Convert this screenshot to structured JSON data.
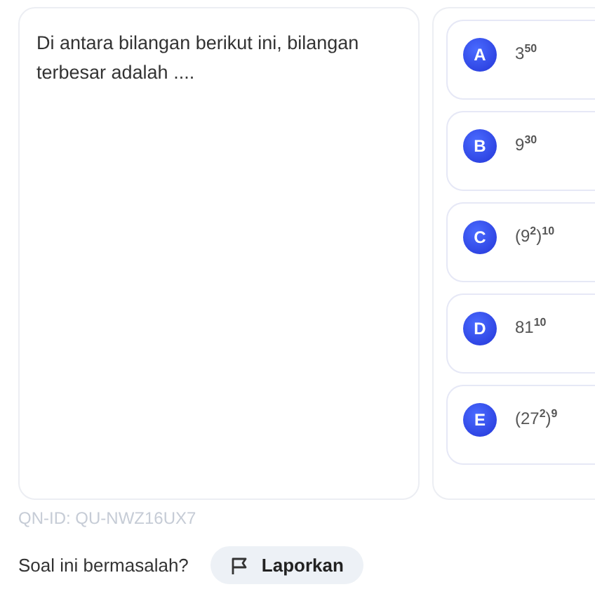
{
  "question": {
    "text": "Di antara bilangan berikut ini, bilangan terbesar adalah ...."
  },
  "options": [
    {
      "letter": "A",
      "text": "3$^{50}$"
    },
    {
      "letter": "B",
      "text": "9$^{30}$"
    },
    {
      "letter": "C",
      "text": "(9$^{2}$)$^{10}$"
    },
    {
      "letter": "D",
      "text": "81$^{10}$"
    },
    {
      "letter": "E",
      "text": "(27$^{2}$)$^{9}$"
    }
  ],
  "question_id": "QN-ID: QU-NWZ16UX7",
  "report": {
    "prompt": "Soal ini bermasalah?",
    "button": "Laporkan"
  }
}
